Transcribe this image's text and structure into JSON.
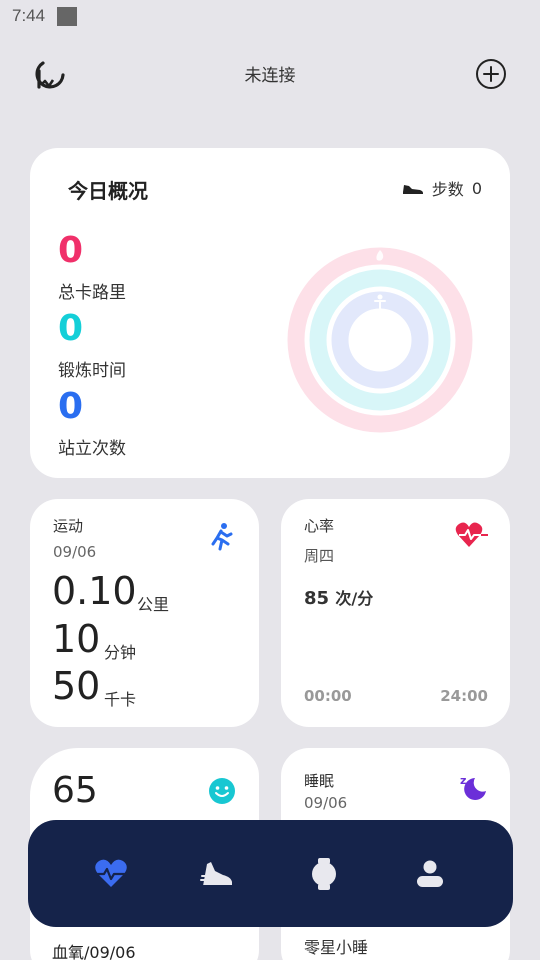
{
  "status_bar": {
    "time": "7:44"
  },
  "header": {
    "title": "未连接",
    "logo_icon": "watch-logo-icon",
    "add_icon": "plus-circle-icon"
  },
  "overview": {
    "title": "今日概况",
    "steps_label": "步数",
    "steps_value": "0",
    "calories": {
      "value": "0",
      "label": "总卡路里",
      "color": "#f0306a"
    },
    "exercise": {
      "value": "0",
      "label": "锻炼时间",
      "color": "#14cfd8"
    },
    "stand": {
      "value": "0",
      "label": "站立次数",
      "color": "#2a6ef0"
    }
  },
  "exercise_card": {
    "title": "运动",
    "date": "09/06",
    "distance": "0.10",
    "distance_unit": "公里",
    "duration": "10",
    "duration_unit": "分钟",
    "calories": "50",
    "calories_unit": "千卡",
    "icon": "running-person-icon"
  },
  "heart_card": {
    "title": "心率",
    "day": "周四",
    "value": "85",
    "unit": "次/分",
    "axis_start": "00:00",
    "axis_end": "24:00",
    "icon": "heart-pulse-icon"
  },
  "spo2_card": {
    "value": "65",
    "label": "血氧/09/06",
    "icon": "smiley-icon"
  },
  "sleep_card": {
    "title": "睡眠",
    "date": "09/06",
    "footer": "零星小睡",
    "icon": "moon-sleep-icon"
  },
  "nav": {
    "items": [
      {
        "name": "health",
        "icon": "heart-pulse-icon",
        "active": true
      },
      {
        "name": "sport",
        "icon": "sneaker-icon",
        "active": false
      },
      {
        "name": "device",
        "icon": "watch-icon",
        "active": false
      },
      {
        "name": "profile",
        "icon": "person-icon",
        "active": false
      }
    ]
  }
}
